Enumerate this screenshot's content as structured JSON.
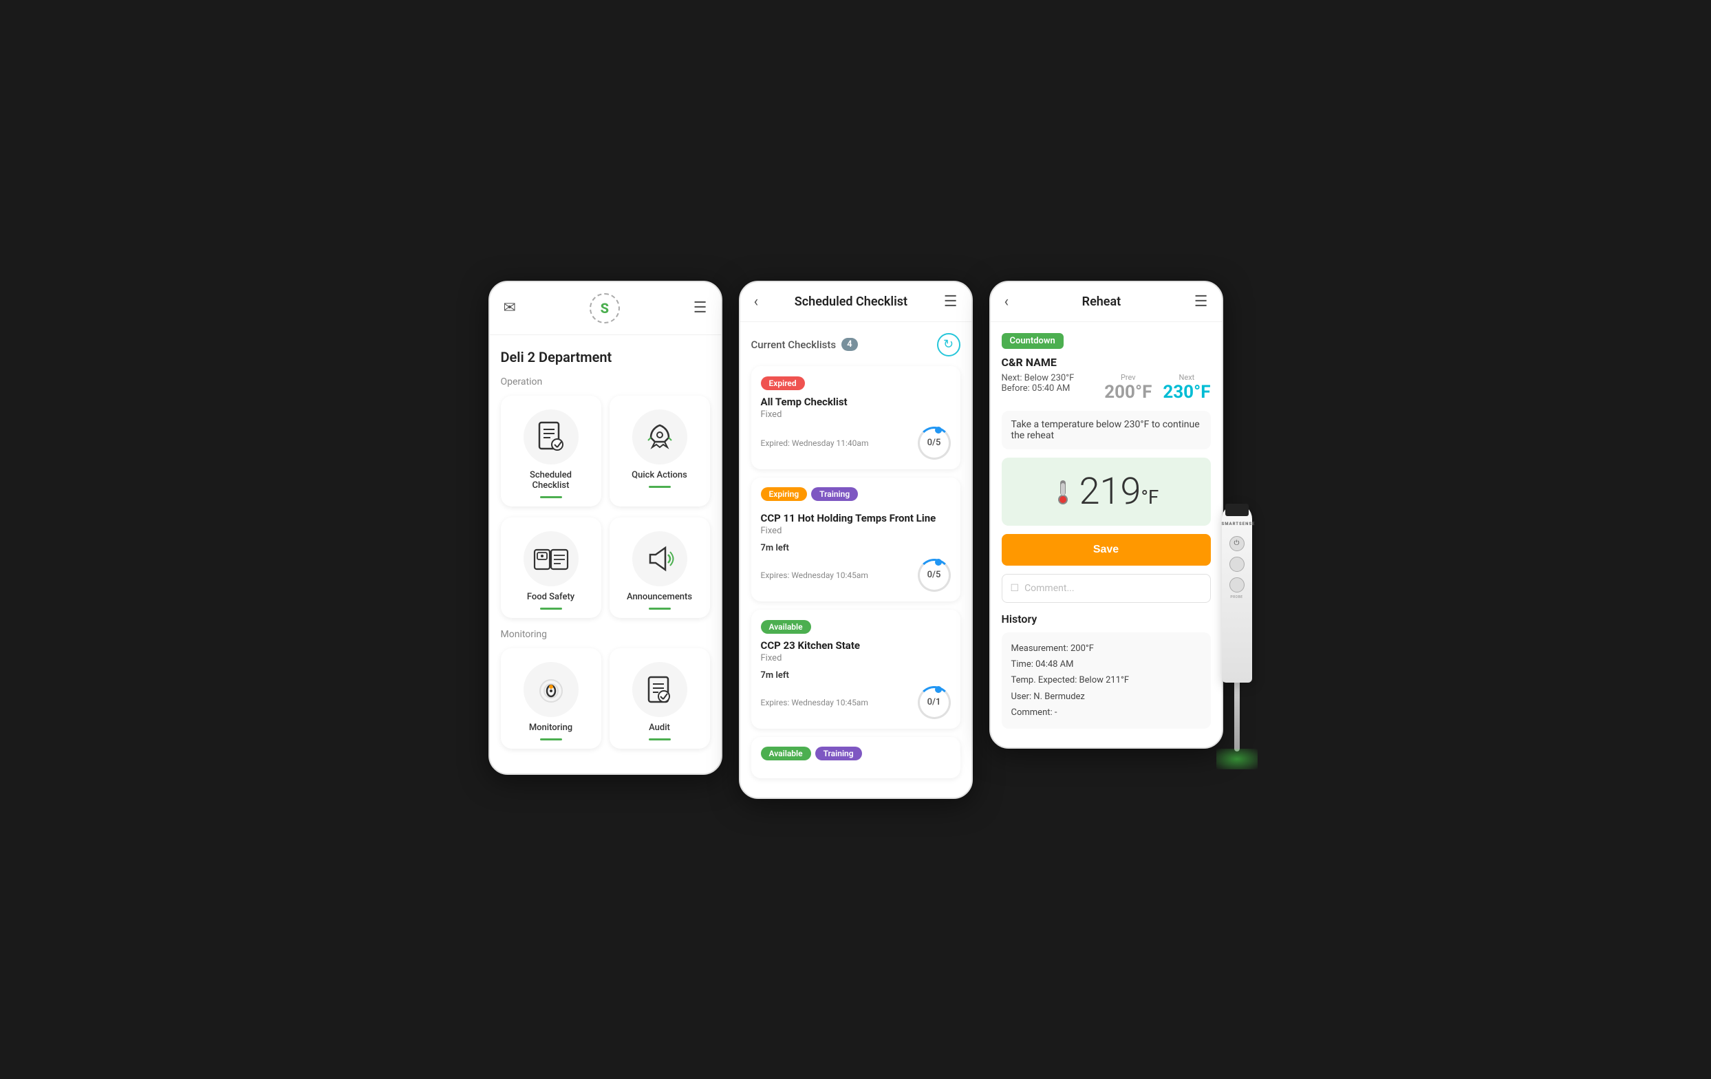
{
  "screen1": {
    "header": {
      "mail_icon": "✉",
      "logo": "S",
      "menu_icon": "☰"
    },
    "dept_title": "Deli 2 Department",
    "operation_label": "Operation",
    "monitoring_label": "Monitoring",
    "menu_items": [
      {
        "id": "scheduled-checklist",
        "label": "Scheduled\nChecklist",
        "icon": "📋"
      },
      {
        "id": "quick-actions",
        "label": "Quick Actions",
        "icon": "🚀"
      },
      {
        "id": "food-safety",
        "label": "Food Safety",
        "icon": "❄"
      },
      {
        "id": "announcements",
        "label": "Announcements",
        "icon": "📣"
      },
      {
        "id": "monitoring",
        "label": "Monitoring",
        "icon": "🔵"
      },
      {
        "id": "audit",
        "label": "Audit",
        "icon": "📋"
      }
    ]
  },
  "screen2": {
    "title": "Scheduled Checklist",
    "current_label": "Current Checklists",
    "count": "4",
    "checklists": [
      {
        "badges": [
          "Expired"
        ],
        "badge_types": [
          "expired"
        ],
        "name": "All Temp Checklist",
        "type": "Fixed",
        "time_info": "Expired: Wednesday 11:40am",
        "progress": "0/5"
      },
      {
        "badges": [
          "Expiring",
          "Training"
        ],
        "badge_types": [
          "expiring",
          "training"
        ],
        "name": "CCP 11 Hot Holding Temps Front Line",
        "type": "Fixed",
        "time_left": "7m left",
        "time_info": "Expires: Wednesday 10:45am",
        "progress": "0/5"
      },
      {
        "badges": [
          "Available"
        ],
        "badge_types": [
          "available"
        ],
        "name": "CCP 23 Kitchen State",
        "type": "Fixed",
        "time_left": "7m left",
        "time_info": "Expires: Wednesday 10:45am",
        "progress": "0/1"
      },
      {
        "badges": [
          "Available",
          "Training"
        ],
        "badge_types": [
          "available",
          "training"
        ],
        "name": "",
        "type": "",
        "time_info": "",
        "progress": ""
      }
    ]
  },
  "screen3": {
    "title": "Reheat",
    "countdown_label": "Countdown",
    "cr_name": "C&R NAME",
    "next_below": "Next: Below 230°F",
    "before_time": "Before: 05:40 AM",
    "prev_label": "Prev",
    "next_label": "Next",
    "prev_temp": "200°F",
    "next_temp": "230°F",
    "instruction": "Take a temperature below 230°F to continue the reheat",
    "current_temp": "219",
    "temp_unit": "°F",
    "save_label": "Save",
    "comment_placeholder": "Comment...",
    "history_title": "History",
    "history": {
      "measurement": "Measurement: 200°F",
      "time": "Time: 04:48 AM",
      "expected": "Temp. Expected: Below 211°F",
      "user": "User: N. Bermudez",
      "comment": "Comment: -"
    }
  }
}
